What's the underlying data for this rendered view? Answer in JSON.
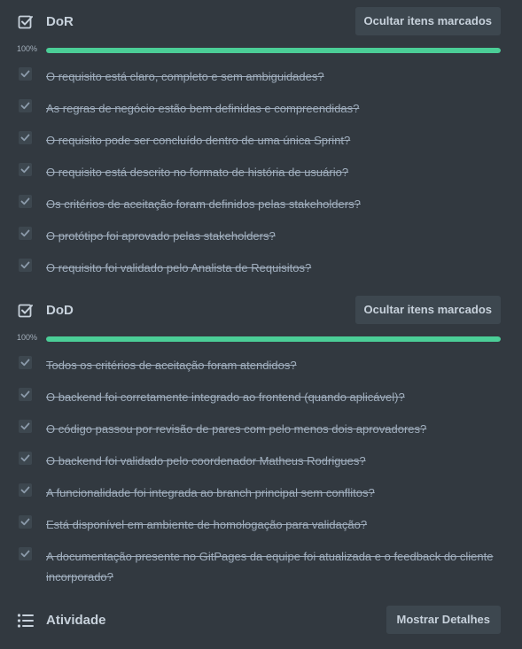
{
  "dor": {
    "title": "DoR",
    "hide_button": "Ocultar itens marcados",
    "progress_label": "100%",
    "progress": 1.0,
    "items": [
      "O requisito está claro, completo e sem ambiguidades?",
      "As regras de negócio estão bem definidas e compreendidas?",
      "O requisito pode ser concluído dentro de uma única Sprint?",
      "O requisito está descrito no formato de história de usuário?",
      "Os critérios de aceitação foram definidos pelas stakeholders?",
      "O protótipo foi aprovado pelas stakeholders?",
      "O requisito foi validado pelo Analista de Requisitos?"
    ]
  },
  "dod": {
    "title": "DoD",
    "hide_button": "Ocultar itens marcados",
    "progress_label": "100%",
    "progress": 1.0,
    "items": [
      "Todos os critérios de aceitação foram atendidos?",
      "O backend foi corretamente integrado ao frontend (quando aplicável)?",
      "O código passou por revisão de pares com pelo menos dois aprovadores?",
      "O backend foi validado pelo coordenador Matheus Rodrigues?",
      "A funcionalidade foi integrada ao branch principal sem conflitos?",
      "Está disponível em ambiente de homologação para validação?",
      "A documentação presente no GitPages da equipe foi atualizada e o feedback do cliente incorporado?"
    ]
  },
  "activity": {
    "title": "Atividade",
    "details_button": "Mostrar Detalhes"
  },
  "colors": {
    "background": "#323940",
    "progress": "#4bce97",
    "button": "#3d474f"
  }
}
